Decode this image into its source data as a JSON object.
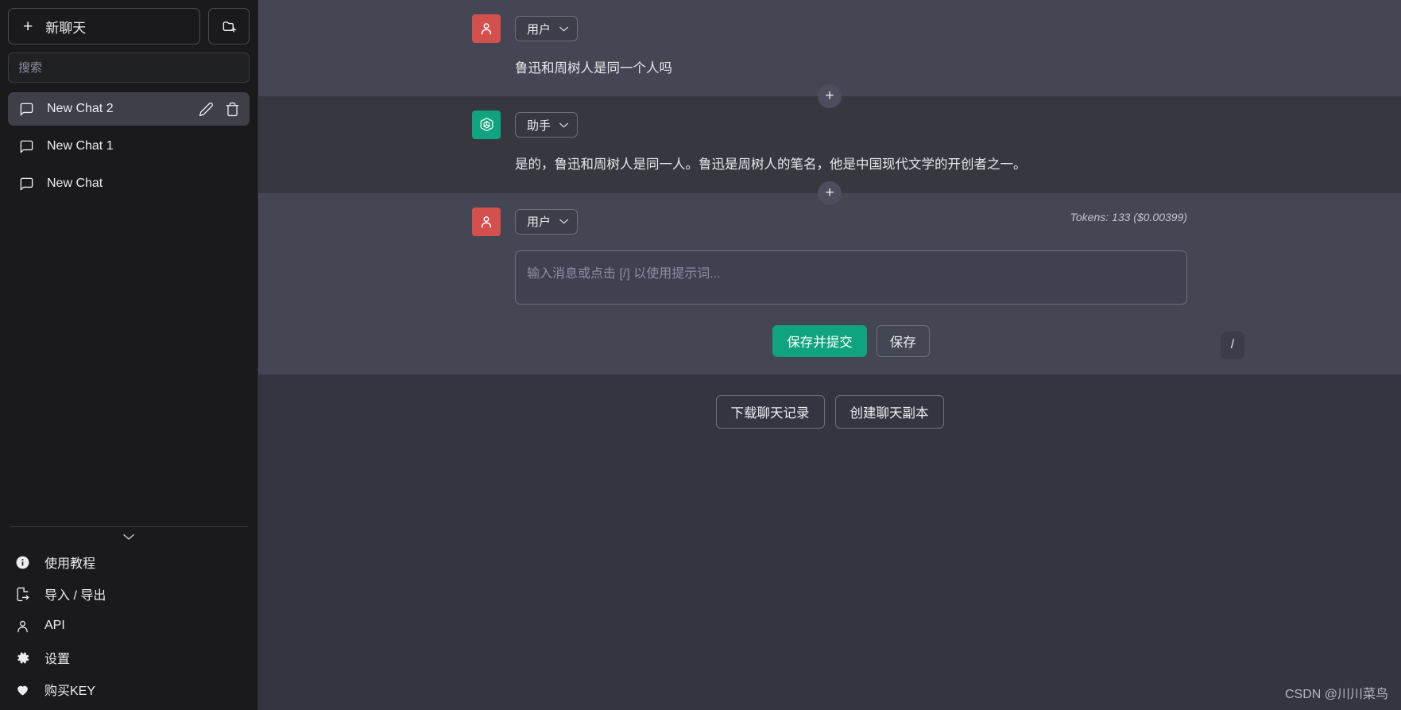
{
  "sidebar": {
    "new_chat_label": "新聊天",
    "new_folder_icon": "folder-plus-icon",
    "search_placeholder": "搜索",
    "search_value": "",
    "chats": [
      {
        "label": "New Chat 2",
        "active": true,
        "icon": "chat-bubble-icon"
      },
      {
        "label": "New Chat 1",
        "active": false,
        "icon": "chat-bubble-icon"
      },
      {
        "label": "New Chat",
        "active": false,
        "icon": "chat-bubble-icon"
      }
    ],
    "collapse_icon": "chevron-down-icon",
    "bottom_items": [
      {
        "label": "使用教程",
        "icon": "info-circle-icon"
      },
      {
        "label": "导入 / 导出",
        "icon": "file-export-icon"
      },
      {
        "label": "API",
        "icon": "user-icon"
      },
      {
        "label": "设置",
        "icon": "gear-icon"
      },
      {
        "label": "购买KEY",
        "icon": "heart-icon"
      }
    ]
  },
  "conversation": {
    "messages": [
      {
        "role_label": "用户",
        "avatar": "user-avatar-icon",
        "avatar_color": "#d4504e",
        "text": "鲁迅和周树人是同一个人吗"
      },
      {
        "role_label": "助手",
        "avatar": "openai-logo-icon",
        "avatar_color": "#10a37f",
        "text": "是的，鲁迅和周树人是同一人。鲁迅是周树人的笔名，他是中国现代文学的开创者之一。"
      }
    ],
    "add_message_icon": "plus-icon",
    "compose": {
      "role_label": "用户",
      "avatar": "user-avatar-icon",
      "tokens_text": "Tokens: 133 ($0.00399)",
      "placeholder": "输入消息或点击 [/] 以使用提示词...",
      "value": "",
      "submit_label": "保存并提交",
      "save_label": "保存",
      "slash_label": "/"
    }
  },
  "footer": {
    "download_label": "下载聊天记录",
    "duplicate_label": "创建聊天副本",
    "watermark": "CSDN @川川菜鸟"
  },
  "colors": {
    "accent_green": "#10a37f",
    "user_avatar_red": "#d4504e",
    "user_block_bg": "#444654",
    "assistant_block_bg": "#37383f",
    "sidebar_bg": "#1a1a1c"
  }
}
